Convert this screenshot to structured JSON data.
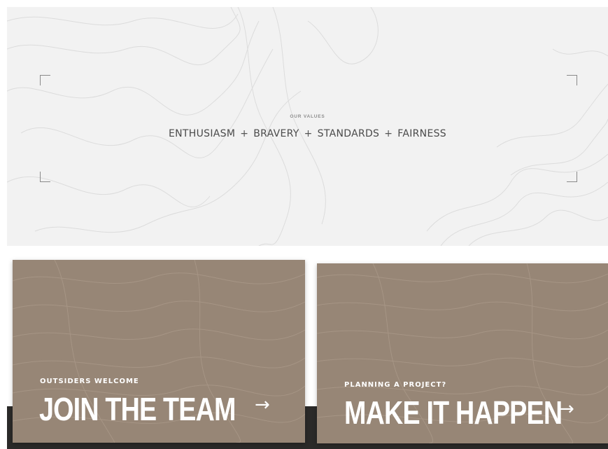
{
  "values_section": {
    "eyebrow": "OUR VALUES",
    "values": [
      "ENTHUSIASM",
      "BRAVERY",
      "STANDARDS",
      "FAIRNESS"
    ],
    "separator": "+"
  },
  "cards": [
    {
      "kicker": "OUTSIDERS WELCOME",
      "headline": "JOIN THE TEAM",
      "arrow": "→"
    },
    {
      "kicker": "PLANNING A PROJECT?",
      "headline": "MAKE IT HAPPEN",
      "arrow": "→"
    }
  ],
  "colors": {
    "card_bg": "#978676",
    "values_bg": "#f2f2f2",
    "text_dark": "#4a4a4a"
  }
}
